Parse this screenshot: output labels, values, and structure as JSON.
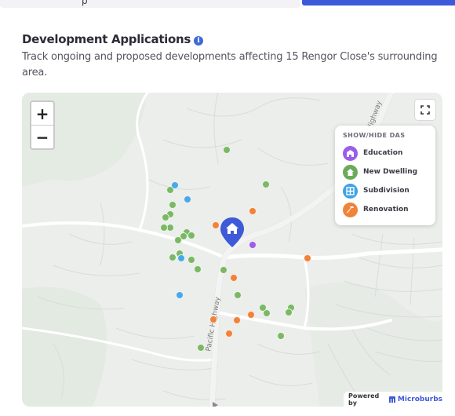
{
  "header": {
    "title": "Development Applications",
    "description": "Track ongoing and proposed developments affecting 15 Rengor Close's surrounding area.",
    "info_icon": "info-icon",
    "search_fragment": "p"
  },
  "map": {
    "zoom_in_label": "+",
    "zoom_out_label": "−",
    "road_labels": [
      "Pacific Highway",
      "Pacific Highway"
    ],
    "fullscreen_icon": "expand-icon",
    "legend": {
      "title": "SHOW/HIDE DAS",
      "items": [
        {
          "label": "Education",
          "color": "#9b5ee8",
          "icon": "school-icon"
        },
        {
          "label": "New Dwelling",
          "color": "#6aab5a",
          "icon": "house-icon"
        },
        {
          "label": "Subdivision",
          "color": "#3fa3e6",
          "icon": "grid-icon"
        },
        {
          "label": "Renovation",
          "color": "#f1823a",
          "icon": "hammer-icon"
        }
      ]
    },
    "property_pin": {
      "color": "#3f5ad8",
      "icon": "home-icon"
    },
    "powered_by": "Powered by",
    "brand": "Microburbs"
  },
  "colors": {
    "accent": "#3f5ad8",
    "education": "#9b5ee8",
    "new_dwelling": "#7bb865",
    "subdivision": "#4aa8e8",
    "renovation": "#f1823a"
  }
}
